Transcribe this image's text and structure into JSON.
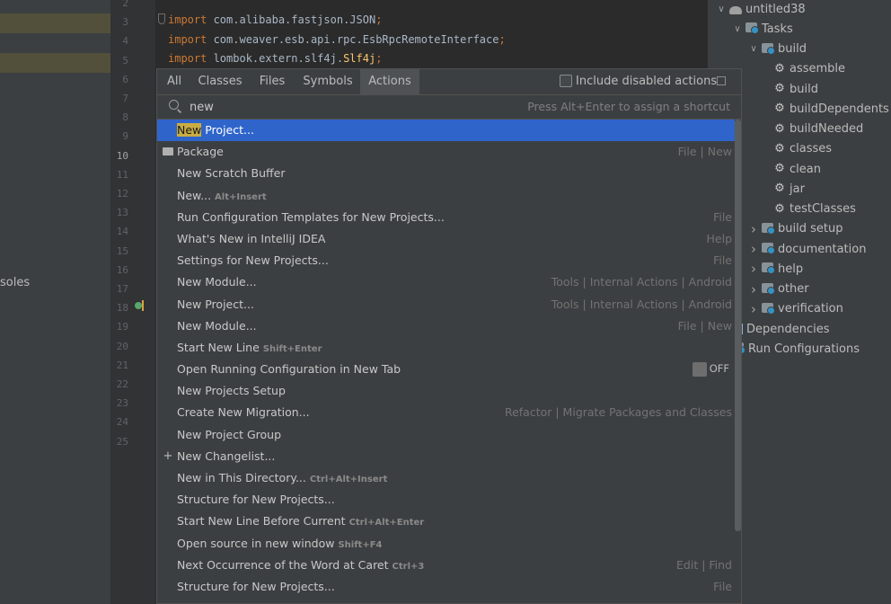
{
  "left_panel": {
    "visible_text": "soles"
  },
  "editor": {
    "line_numbers": [
      "2",
      "3",
      "4",
      "5",
      "6",
      "7",
      "8",
      "9",
      "10",
      "11",
      "12",
      "13",
      "14",
      "15",
      "16",
      "17",
      "18",
      "19",
      "20",
      "21",
      "22",
      "23",
      "24",
      "25"
    ],
    "current_line": "10",
    "code_lines": [
      {
        "keyword": "import",
        "text": " com.alibaba.fastjson.JSON",
        "cls": "",
        "end": ";"
      },
      {
        "keyword": "import",
        "text": " com.weaver.esb.api.rpc.EsbRpcRemoteInterface",
        "cls": "",
        "end": ";"
      },
      {
        "keyword": "import",
        "text": " lombok.extern.slf4j.",
        "cls": "Slf4j",
        "end": ";"
      }
    ]
  },
  "popup": {
    "tabs": [
      "All",
      "Classes",
      "Files",
      "Symbols",
      "Actions"
    ],
    "active_tab": "Actions",
    "include_disabled_label": "Include disabled actions",
    "search": {
      "value": "new",
      "hint": "Press Alt+Enter to assign a shortcut"
    },
    "results": [
      {
        "match": "New",
        "rest": " Project...",
        "shortcut": "",
        "group": "",
        "selected": true,
        "icon": ""
      },
      {
        "match": "",
        "rest": "Package",
        "shortcut": "",
        "group": "File | New",
        "icon": "package-icon"
      },
      {
        "match": "",
        "rest": "New Scratch Buffer",
        "shortcut": "",
        "group": ""
      },
      {
        "match": "",
        "rest": "New...",
        "shortcut": "Alt+Insert",
        "group": ""
      },
      {
        "match": "",
        "rest": "Run Configuration Templates for New Projects...",
        "shortcut": "",
        "group": "File"
      },
      {
        "match": "",
        "rest": "What's New in IntelliJ IDEA",
        "shortcut": "",
        "group": "Help"
      },
      {
        "match": "",
        "rest": "Settings for New Projects...",
        "shortcut": "",
        "group": "File"
      },
      {
        "match": "",
        "rest": "New Module...",
        "shortcut": "",
        "group": "Tools | Internal Actions | Android"
      },
      {
        "match": "",
        "rest": "New Project...",
        "shortcut": "",
        "group": "Tools | Internal Actions | Android"
      },
      {
        "match": "",
        "rest": "New Module...",
        "shortcut": "",
        "group": "File | New"
      },
      {
        "match": "",
        "rest": "Start New Line",
        "shortcut": "Shift+Enter",
        "group": ""
      },
      {
        "match": "",
        "rest": "Open Running Configuration in New Tab",
        "shortcut": "",
        "group": "",
        "toggle": "OFF"
      },
      {
        "match": "",
        "rest": "New Projects Setup",
        "shortcut": "",
        "group": ""
      },
      {
        "match": "",
        "rest": "Create New Migration...",
        "shortcut": "",
        "group": "Refactor | Migrate Packages and Classes"
      },
      {
        "match": "",
        "rest": "New Project Group",
        "shortcut": "",
        "group": ""
      },
      {
        "match": "",
        "rest": "New Changelist...",
        "shortcut": "",
        "group": "",
        "icon": "plus-icon"
      },
      {
        "match": "",
        "rest": "New in This Directory...",
        "shortcut": "Ctrl+Alt+Insert",
        "group": ""
      },
      {
        "match": "",
        "rest": "Structure for New Projects...",
        "shortcut": "",
        "group": ""
      },
      {
        "match": "",
        "rest": "Start New Line Before Current",
        "shortcut": "Ctrl+Alt+Enter",
        "group": ""
      },
      {
        "match": "",
        "rest": "Open source in new window",
        "shortcut": "Shift+F4",
        "group": ""
      },
      {
        "match": "",
        "rest": "Next Occurrence of the Word at Caret",
        "shortcut": "Ctrl+3",
        "group": "Edit | Find"
      },
      {
        "match": "",
        "rest": "Structure for New Projects...",
        "shortcut": "",
        "group": "File"
      }
    ]
  },
  "gradle_tree": [
    {
      "label": "untitled38",
      "chev": "down",
      "icon": "elephant-icon",
      "level": 0
    },
    {
      "label": "Tasks",
      "chev": "down",
      "icon": "folder-icon",
      "level": 1
    },
    {
      "label": "build",
      "chev": "down",
      "icon": "folder-icon",
      "level": 2
    },
    {
      "label": "assemble",
      "chev": "",
      "icon": "gear-icon",
      "level": 3
    },
    {
      "label": "build",
      "chev": "",
      "icon": "gear-icon",
      "level": 3
    },
    {
      "label": "buildDependents",
      "chev": "",
      "icon": "gear-icon",
      "level": 3
    },
    {
      "label": "buildNeeded",
      "chev": "",
      "icon": "gear-icon",
      "level": 3
    },
    {
      "label": "classes",
      "chev": "",
      "icon": "gear-icon",
      "level": 3
    },
    {
      "label": "clean",
      "chev": "",
      "icon": "gear-icon",
      "level": 3
    },
    {
      "label": "jar",
      "chev": "",
      "icon": "gear-icon",
      "level": 3
    },
    {
      "label": "testClasses",
      "chev": "",
      "icon": "gear-icon",
      "level": 3
    },
    {
      "label": "build setup",
      "chev": "right",
      "icon": "folder-icon",
      "level": 2
    },
    {
      "label": "documentation",
      "chev": "right",
      "icon": "folder-icon",
      "level": 2
    },
    {
      "label": "help",
      "chev": "right",
      "icon": "folder-icon",
      "level": 2
    },
    {
      "label": "other",
      "chev": "right",
      "icon": "folder-icon",
      "level": 2
    },
    {
      "label": "verification",
      "chev": "right",
      "icon": "folder-icon",
      "level": 2
    },
    {
      "label": "Dependencies",
      "chev": "",
      "icon": "dependencies-icon",
      "level": 1
    },
    {
      "label": "Run Configurations",
      "chev": "",
      "icon": "folder-icon",
      "level": 1
    }
  ]
}
